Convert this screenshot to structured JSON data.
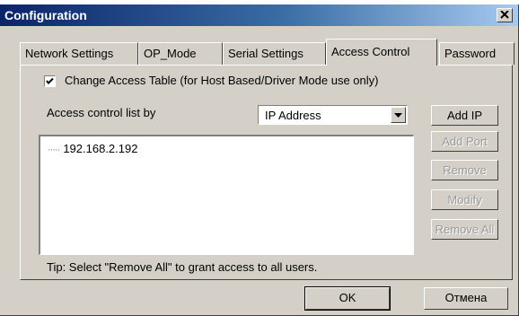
{
  "window": {
    "title": "Configuration",
    "close_label": "×"
  },
  "tabs": [
    {
      "label": "Network Settings"
    },
    {
      "label": "OP_Mode"
    },
    {
      "label": "Serial Settings"
    },
    {
      "label": "Access Control"
    },
    {
      "label": "Password"
    }
  ],
  "access_control": {
    "change_table_label": "Change Access Table (for Host Based/Driver Mode use only)",
    "change_table_checked": true,
    "list_by_label": "Access control list by",
    "list_by_value": "IP Address",
    "entries": [
      "192.168.2.192"
    ],
    "tip": "Tip: Select \"Remove All\" to grant access to all users.",
    "buttons": {
      "add_ip": "Add IP",
      "add_port": "Add Port",
      "remove": "Remove",
      "modify": "Modify",
      "remove_all": "Remove All"
    }
  },
  "footer": {
    "ok": "OK",
    "cancel": "Отмена"
  }
}
